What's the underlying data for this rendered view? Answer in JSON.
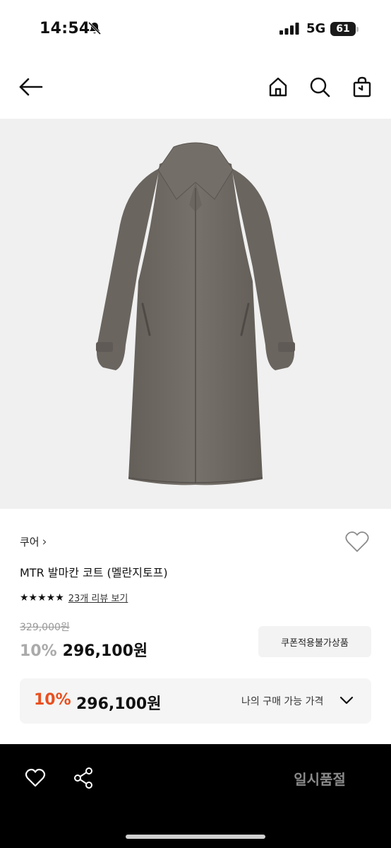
{
  "status_bar": {
    "time": "14:54",
    "network": "5G",
    "battery": "61"
  },
  "nav": {
    "back_icon": "arrow-left-icon",
    "home_icon": "home-icon",
    "search_icon": "search-icon",
    "bag_icon": "shopping-bag-icon"
  },
  "product": {
    "image_icon": "coat-image",
    "brand": "쿠어",
    "brand_chevron": "›",
    "title": "MTR 발마칸 코트 (멜란지토프)",
    "stars": "★★★★★",
    "rating": 5,
    "review_link": "23개 리뷰 보기",
    "original_price": "329,000원",
    "discount_percent": "10%",
    "sale_price": "296,100원",
    "coupon_label": "쿠폰적용불가상품"
  },
  "my_price": {
    "discount_percent": "10%",
    "price": "296,100원",
    "label": "나의 구매 가능 가격"
  },
  "bottom_bar": {
    "soldout_label": "일시품절"
  },
  "colors": {
    "accent_orange": "#e8501f",
    "bottom_bar": "#000000",
    "image_bg": "#f0f0f0",
    "coat": "#6f6a64"
  }
}
